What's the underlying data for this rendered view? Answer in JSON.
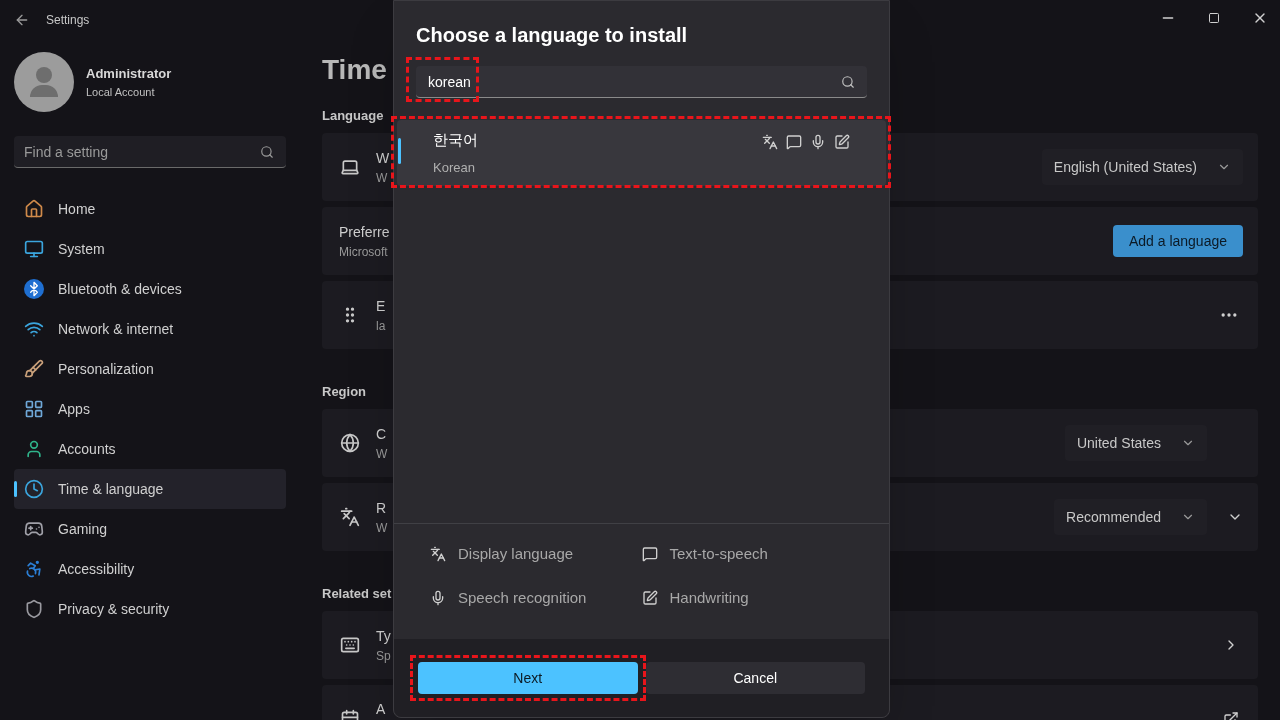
{
  "window": {
    "title": "Settings"
  },
  "profile": {
    "name": "Administrator",
    "account": "Local Account"
  },
  "search": {
    "placeholder": "Find a setting"
  },
  "nav": [
    {
      "label": "Home",
      "selected": false
    },
    {
      "label": "System",
      "selected": false
    },
    {
      "label": "Bluetooth & devices",
      "selected": false
    },
    {
      "label": "Network & internet",
      "selected": false
    },
    {
      "label": "Personalization",
      "selected": false
    },
    {
      "label": "Apps",
      "selected": false
    },
    {
      "label": "Accounts",
      "selected": false
    },
    {
      "label": "Time & language",
      "selected": true
    },
    {
      "label": "Gaming",
      "selected": false
    },
    {
      "label": "Accessibility",
      "selected": false
    },
    {
      "label": "Privacy & security",
      "selected": false
    }
  ],
  "page": {
    "title": "Time",
    "sections": [
      {
        "heading": "Language",
        "cards": [
          {
            "kind": "dropdown",
            "title": "W",
            "subtitle": "W",
            "value": "English (United States)"
          },
          {
            "kind": "button",
            "title": "Preferre",
            "subtitle": "Microsoft",
            "action": "Add a language"
          },
          {
            "kind": "more",
            "title": "E",
            "subtitle": "la"
          }
        ]
      },
      {
        "heading": "Region",
        "cards": [
          {
            "kind": "dropdown",
            "title": "C",
            "subtitle": "W",
            "value": "United States",
            "expandable": false
          },
          {
            "kind": "dropdown",
            "title": "R",
            "subtitle": "W",
            "value": "Recommended",
            "expandable": true
          }
        ]
      },
      {
        "heading": "Related set",
        "cards": [
          {
            "kind": "link",
            "title": "Ty",
            "subtitle": "Sp"
          },
          {
            "kind": "external",
            "title": "A"
          }
        ]
      }
    ]
  },
  "dialog": {
    "title": "Choose a language to install",
    "search": {
      "value": "korean",
      "highlighted": true
    },
    "results": [
      {
        "name": "한국어",
        "english": "Korean",
        "selected": true,
        "highlighted": true
      }
    ],
    "features": [
      {
        "label": "Display language"
      },
      {
        "label": "Text-to-speech"
      },
      {
        "label": "Speech recognition"
      },
      {
        "label": "Handwriting"
      }
    ],
    "buttons": [
      {
        "label": "Next",
        "kind": "primary",
        "highlighted": true
      },
      {
        "label": "Cancel",
        "kind": "secondary",
        "highlighted": false
      }
    ]
  }
}
